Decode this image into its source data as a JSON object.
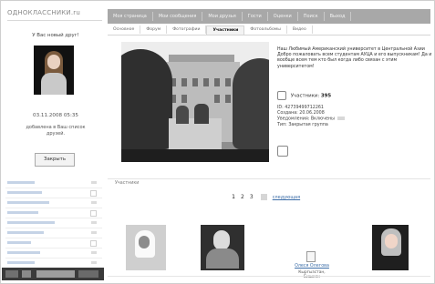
{
  "header": {
    "logo": "ОДНОКЛАССНИКИ.ru",
    "nav": [
      "Моя страница",
      "Мои сообщения",
      "Мои друзья",
      "Гости",
      "Оценки",
      "Поиск",
      "Выход"
    ]
  },
  "left": {
    "notice_title": "У Вас новый друг!",
    "photo_caption": "",
    "date": "03.11.2008 05:35",
    "added_text": "добавлена в Ваш список друзей.",
    "close_label": "Закрыть",
    "menu_rows": 10
  },
  "tabs": [
    {
      "label": "Основное",
      "active": false
    },
    {
      "label": "Форум",
      "active": false
    },
    {
      "label": "Фотографии",
      "active": false
    },
    {
      "label": "Участники",
      "active": true
    },
    {
      "label": "Фотоальбомы",
      "active": false
    },
    {
      "label": "Видео",
      "active": false
    }
  ],
  "group": {
    "heading": "",
    "description": "Наш Любимый Американский университет в Центральной Азии Добро пожаловать всем студентам АУЦА и его выпускникам! Да и вообще всем тем кто был когда либо связан с этим университетом!",
    "members_label": "Участники:",
    "members_count": "395",
    "meta": [
      "ID: 42739499712261",
      "Создана: 20.06.2008",
      "Уведомления: Включены",
      "Тип: Закрытая группа"
    ],
    "invite_label": ""
  },
  "members_section": {
    "title": "Участники",
    "pages": [
      "1",
      "2",
      "3"
    ],
    "current_page": "1",
    "next_link": "следующая"
  },
  "members": [
    {
      "name": "",
      "city": "",
      "has_photo": true
    },
    {
      "name": "",
      "city": "",
      "has_photo": true
    },
    {
      "name": "Олеся Олегова",
      "city": "Кыргызстан, Бишкек",
      "has_photo": false
    },
    {
      "name": "",
      "city": "",
      "has_photo": true
    }
  ],
  "colors": {
    "nav_bg": "#a8a8a8",
    "link": "#3d6ea8"
  }
}
